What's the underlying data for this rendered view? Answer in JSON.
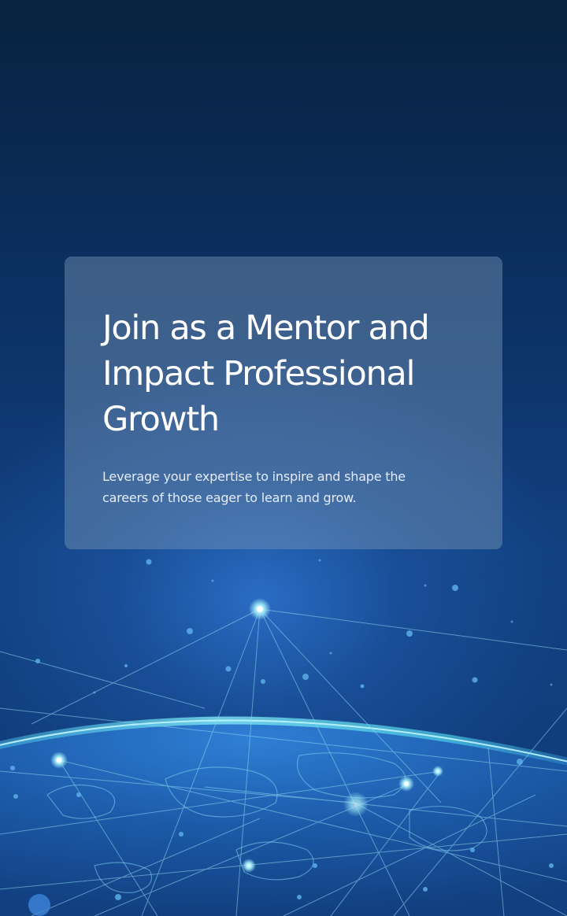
{
  "hero": {
    "title": "Join as a Mentor and Impact Professional Growth",
    "subtitle": "Leverage your expertise to inspire and shape the careers of those eager to learn and grow."
  },
  "colors": {
    "background_top": "#08223f",
    "background_bottom": "#0f3a78",
    "glow": "#2a6cc4",
    "card": "#7896b9",
    "accent_cyan": "#4fd6e8"
  }
}
